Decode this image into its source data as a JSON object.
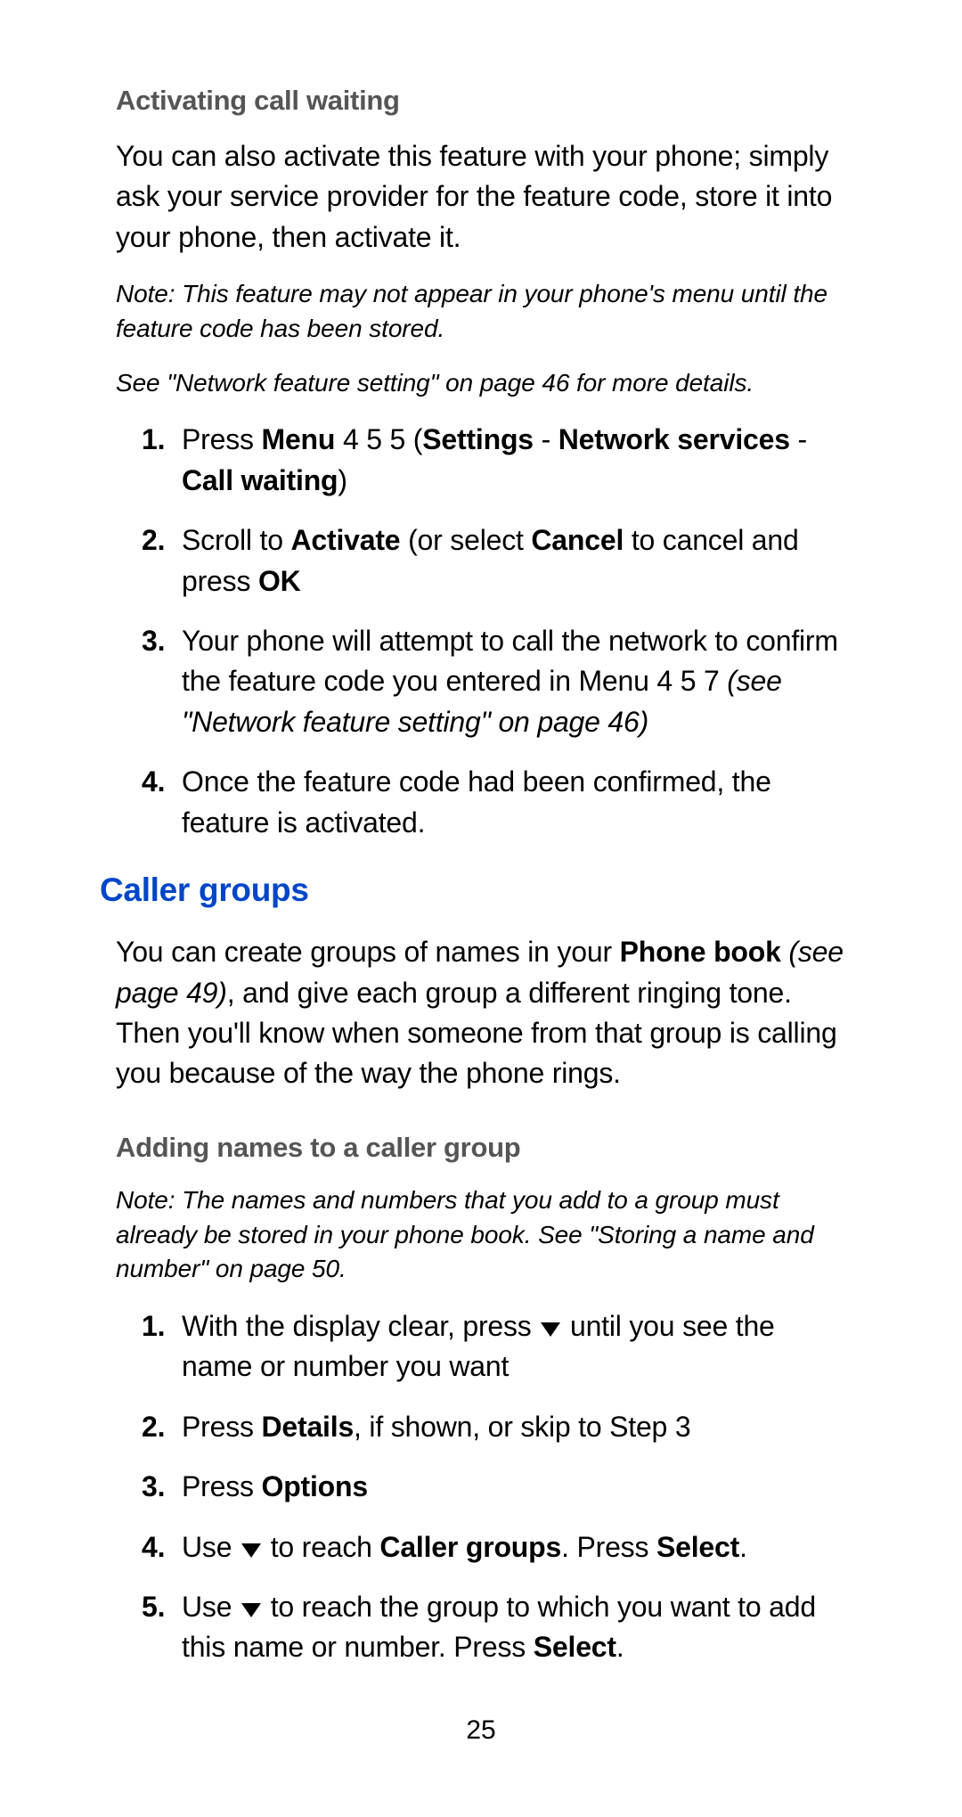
{
  "section1": {
    "heading": "Activating call waiting",
    "intro": "You can also activate this feature with your phone; simply ask your service provider for the feature code, store it into your phone, then activate it.",
    "note1": "Note: This feature may not appear in your phone's menu until the feature code has been stored.",
    "note2": "See \"Network feature setting\" on page 46 for more details.",
    "steps": {
      "s1": {
        "p1": "Press ",
        "menu": "Menu",
        "p2": " 4 5 5 (",
        "settings": "Settings",
        "dash1": " - ",
        "network": "Network services",
        "dash2": " - ",
        "callw": "Call waiting",
        "p3": ")"
      },
      "s2": {
        "p1": "Scroll to ",
        "activate": "Activate",
        "p2": " (or select ",
        "cancel": "Cancel",
        "p3": " to cancel and press ",
        "ok": "OK"
      },
      "s3": {
        "p1": "Your phone will attempt to call the network to con­firm the feature code you entered in Menu 4 5 7 ",
        "ref": "(see \"Network feature setting\" on page 46)"
      },
      "s4": "Once the feature code had been confirmed, the feature is activated."
    }
  },
  "section2": {
    "heading": "Caller groups",
    "intro": {
      "p1": "You can create groups of names in your ",
      "phonebook": "Phone book",
      "p2": " ",
      "ref": "(see page 49)",
      "p3": ", and give each group a different ringing tone. Then you'll know when someone from that group is calling you because of the way the phone rings."
    },
    "subheading": "Adding names to a caller group",
    "note": "Note: The names and numbers that you add to a group must already be stored in your phone book. See \"Storing a name and number\" on page 50.",
    "steps": {
      "s1": {
        "p1": "With the display clear, press ",
        "p2": " until you see the name or number you want"
      },
      "s2": {
        "p1": "Press ",
        "details": "Details",
        "p2": ", if shown, or skip to Step 3"
      },
      "s3": {
        "p1": "Press ",
        "options": "Options"
      },
      "s4": {
        "p1": "Use ",
        "p2": " to reach ",
        "cg": "Caller groups",
        "p3": ". Press ",
        "select": "Select",
        "p4": "."
      },
      "s5": {
        "p1": "Use ",
        "p2": " to reach the group to which you want to add this name or number. Press ",
        "select": "Select",
        "p4": "."
      }
    }
  },
  "page_number": "25"
}
